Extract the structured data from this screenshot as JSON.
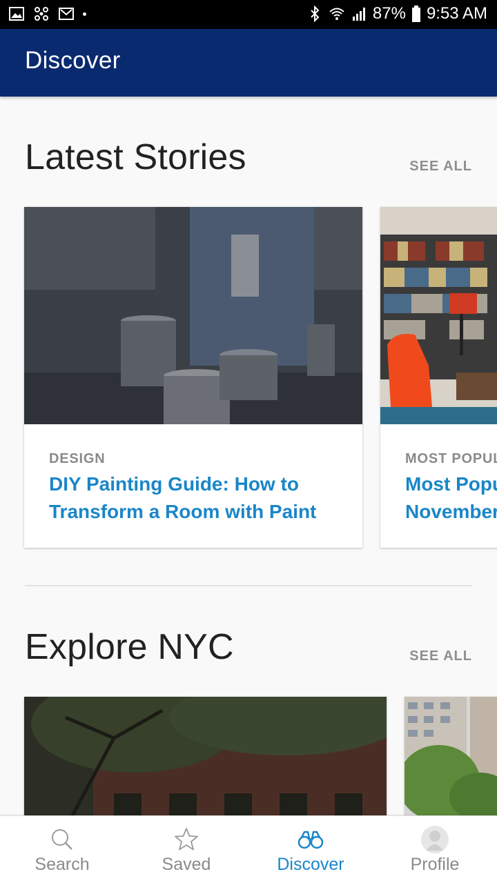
{
  "status_bar": {
    "battery": "87%",
    "time": "9:53 AM"
  },
  "app_bar": {
    "title": "Discover"
  },
  "sections": {
    "latest": {
      "title": "Latest Stories",
      "see_all": "SEE ALL",
      "cards": [
        {
          "category": "DESIGN",
          "title_line1": "DIY Painting Guide: How to",
          "title_line2": "Transform a Room with Paint"
        },
        {
          "category": "MOST POPUL",
          "title_line1": "Most Popu",
          "title_line2": "November"
        }
      ]
    },
    "explore": {
      "title": "Explore NYC",
      "see_all": "SEE ALL"
    }
  },
  "bottom_nav": {
    "items": [
      {
        "label": "Search",
        "icon": "search-icon"
      },
      {
        "label": "Saved",
        "icon": "star-icon"
      },
      {
        "label": "Discover",
        "icon": "binoculars-icon",
        "active": true
      },
      {
        "label": "Profile",
        "icon": "avatar-icon"
      }
    ]
  },
  "colors": {
    "app_bar": "#0a2a70",
    "accent": "#1a86c8",
    "muted": "#8e8e8e"
  }
}
